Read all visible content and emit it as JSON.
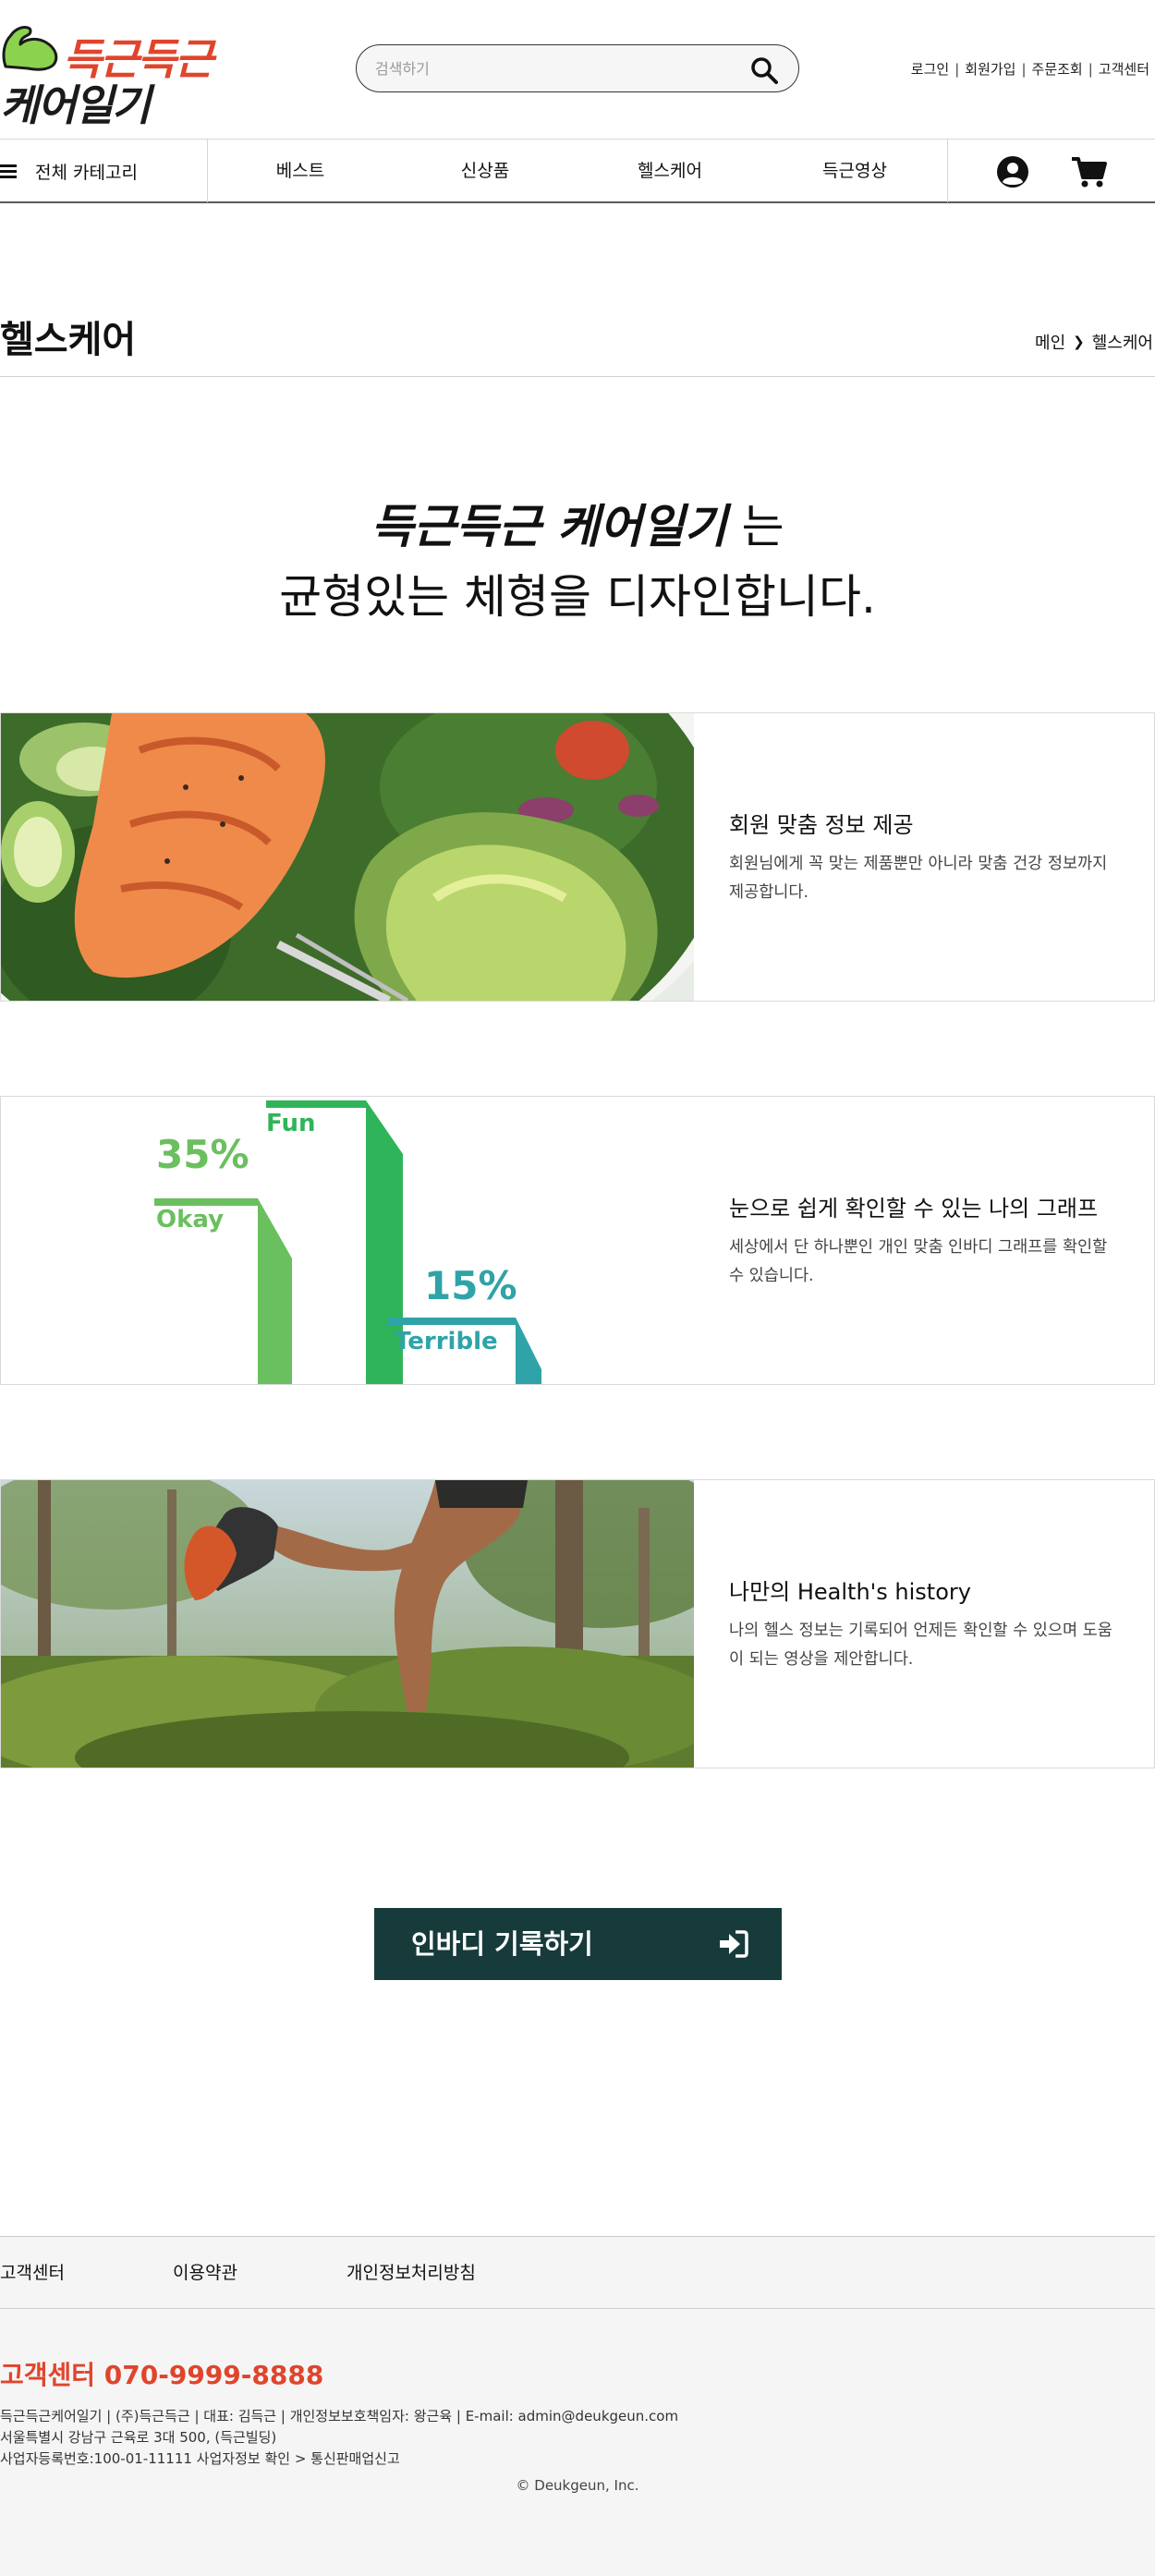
{
  "brand": {
    "logo_line1": "득근득근",
    "logo_line2": "케어일기",
    "accent_color": "#e0452c",
    "dark_color": "#163b3a"
  },
  "header": {
    "search_placeholder": "검색하기",
    "top_links": [
      "로그인",
      "회원가입",
      "주문조회",
      "고객센터"
    ]
  },
  "nav": {
    "all_categories": "전체 카테고리",
    "items": [
      "베스트",
      "신상품",
      "헬스케어",
      "득근영상"
    ],
    "icons": [
      "user-account-icon",
      "cart-icon"
    ]
  },
  "page": {
    "title": "헬스케어",
    "breadcrumb": [
      "메인",
      "헬스케어"
    ]
  },
  "hero": {
    "brand_text": "득근득근 케어일기",
    "line1_suffix": " 는",
    "line2": "균형있는 체형을 디자인합니다."
  },
  "features": [
    {
      "title": "회원 맞춤 정보 제공",
      "desc": "회원님에게 꼭 맞는 제품뿐만 아니라 맞춤 건강 정보까지 제공합니다.",
      "image": "salmon-salad-photo"
    },
    {
      "title": "눈으로 쉽게 확인할 수 있는 나의 그래프",
      "desc": "세상에서 단 하나뿐인 개인 맞춤 인바디 그래프를 확인할 수 있습니다.",
      "image": "graph-illustration",
      "graph": {
        "labels": [
          "Okay",
          "Fun",
          "Terrible"
        ],
        "percent_okay": "35%",
        "percent_terrible": "15%",
        "colors": [
          "#6abf5e",
          "#2fb45a",
          "#2fa3a8"
        ]
      }
    },
    {
      "title": "나만의 Health's history",
      "desc": "나의 헬스 정보는 기록되어 언제든 확인할 수 있으며 도움이 되는 영상을 제안합니다.",
      "image": "running-legs-photo"
    }
  ],
  "cta": {
    "label": "인바디 기록하기",
    "icon": "sign-in-icon"
  },
  "footer": {
    "links": [
      "고객센터",
      "이용약관",
      "개인정보처리방침"
    ],
    "phone": "고객센터 070-9999-8888",
    "info_line1": "득근득근케어일기 | (주)득근득근 | 대표: 김득근 | 개인정보보호책임자: 왕근육 | E-mail: admin@deukgeun.com",
    "info_line2": "서울특별시 강남구 근육로 3대 500, (득근빌딩)",
    "info_line3": "사업자등록번호:100-01-11111 사업자정보 확인 > 통신판매업신고",
    "copyright": "© Deukgeun, Inc."
  }
}
